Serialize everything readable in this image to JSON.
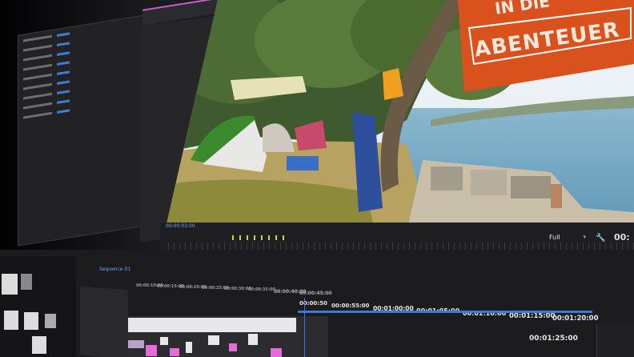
{
  "program_monitor": {
    "timecode": "00:00:03:00",
    "zoom_level": "Full",
    "right_timecode": "00:",
    "video_banner_text": "ABENTEUER",
    "video_banner_top": "IN DIE"
  },
  "transport_buttons": [
    "▼",
    "{",
    "}",
    "|◀",
    "◀",
    "▶",
    "▶|",
    "▶▶",
    "⇲",
    "⇱",
    "◙",
    "▣"
  ],
  "timeline": {
    "sequence_tab": "Sequence 01",
    "timecodes_small": [
      "00:00:10:00",
      "00:00:15:00",
      "00:00:20:00",
      "00:00:25:00",
      "00:00:30:00",
      "00:00:35:00",
      "00:00:40:00",
      "00:00:45:00"
    ],
    "timecodes": [
      "00:00:50",
      "00:00:55:00",
      "00:01:00:00",
      "00:01:05:00",
      "00:01:10:00",
      "00:01:15:00",
      "00:01:20:00",
      "00:01:25:00"
    ]
  }
}
